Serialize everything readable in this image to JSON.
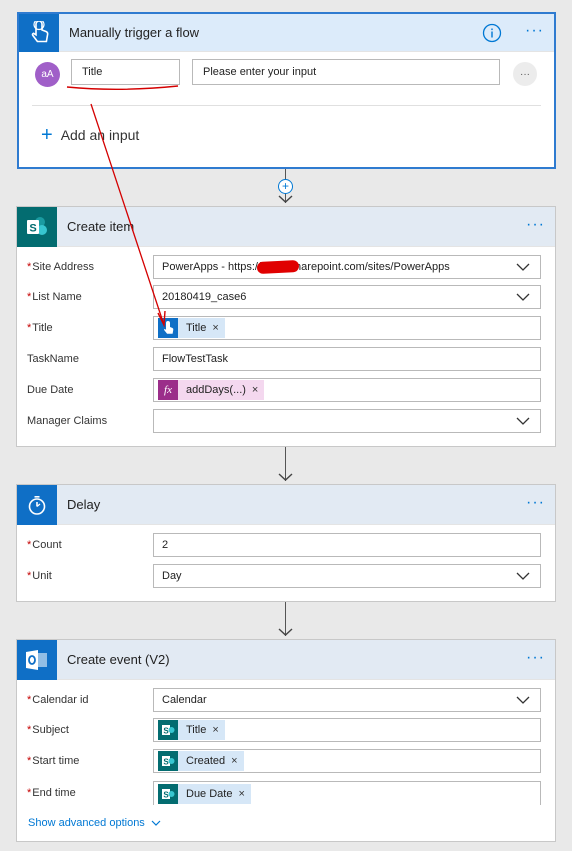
{
  "trigger": {
    "title": "Manually trigger a flow",
    "avatar": "aA",
    "input_name": "Title",
    "input_placeholder": "Please enter your input",
    "add_input": "Add an input"
  },
  "create_item": {
    "title": "Create item",
    "fields": [
      {
        "label": "Site Address",
        "required": true,
        "value": "PowerApps - https://",
        "value_tail": "harepoint.com/sites/PowerApps",
        "dropdown": true
      },
      {
        "label": "List Name",
        "required": true,
        "value": "20180419_case6",
        "dropdown": true
      },
      {
        "label": "Title",
        "required": true,
        "token": "Title"
      },
      {
        "label": "TaskName",
        "required": false,
        "value": "FlowTestTask"
      },
      {
        "label": "Due Date",
        "required": false,
        "token": "addDays(...)"
      },
      {
        "label": "Manager Claims",
        "required": false,
        "value": "",
        "dropdown": true
      }
    ]
  },
  "delay": {
    "title": "Delay",
    "fields": [
      {
        "label": "Count",
        "required": true,
        "value": "2"
      },
      {
        "label": "Unit",
        "required": true,
        "value": "Day"
      }
    ]
  },
  "create_event": {
    "title": "Create event (V2)",
    "fields": [
      {
        "label": "Calendar id",
        "required": true,
        "value": "Calendar"
      },
      {
        "label": "Subject",
        "required": true,
        "token": "Title"
      },
      {
        "label": "Start time",
        "required": true,
        "token": "Created"
      },
      {
        "label": "End time",
        "required": true,
        "token": "Due Date"
      }
    ],
    "advanced": "Show advanced options"
  },
  "common": {
    "more": "···",
    "star": "*",
    "remove": "×"
  },
  "colors": {
    "accent": "#0078d4",
    "sharepoint": "#036c70",
    "outlook": "#0f6fc6",
    "annotation": "#d40000",
    "formula": "#9b2e8a"
  }
}
